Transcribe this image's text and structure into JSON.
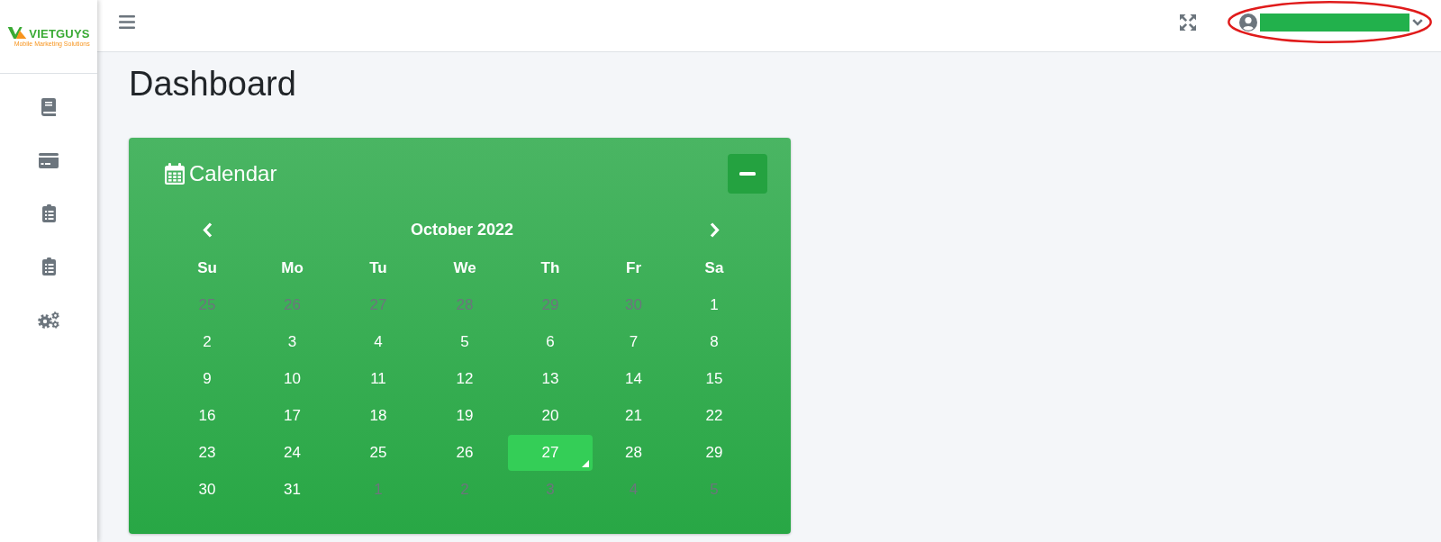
{
  "logo": {
    "name": "VIETGUYS",
    "tagline": "Mobile Marketing Solutions"
  },
  "page": {
    "title": "Dashboard"
  },
  "calendar": {
    "title": "Calendar",
    "month": "October 2022",
    "weekdays": [
      "Su",
      "Mo",
      "Tu",
      "We",
      "Th",
      "Fr",
      "Sa"
    ],
    "days": [
      {
        "label": "25",
        "muted": true,
        "selected": false,
        "today": false
      },
      {
        "label": "26",
        "muted": true,
        "selected": false,
        "today": false
      },
      {
        "label": "27",
        "muted": true,
        "selected": false,
        "today": false
      },
      {
        "label": "28",
        "muted": true,
        "selected": false,
        "today": false
      },
      {
        "label": "29",
        "muted": true,
        "selected": false,
        "today": false
      },
      {
        "label": "30",
        "muted": true,
        "selected": false,
        "today": false
      },
      {
        "label": "1",
        "muted": false,
        "selected": false,
        "today": false
      },
      {
        "label": "2",
        "muted": false,
        "selected": false,
        "today": false
      },
      {
        "label": "3",
        "muted": false,
        "selected": false,
        "today": false
      },
      {
        "label": "4",
        "muted": false,
        "selected": false,
        "today": false
      },
      {
        "label": "5",
        "muted": false,
        "selected": false,
        "today": false
      },
      {
        "label": "6",
        "muted": false,
        "selected": false,
        "today": false
      },
      {
        "label": "7",
        "muted": false,
        "selected": false,
        "today": false
      },
      {
        "label": "8",
        "muted": false,
        "selected": false,
        "today": false
      },
      {
        "label": "9",
        "muted": false,
        "selected": false,
        "today": false
      },
      {
        "label": "10",
        "muted": false,
        "selected": false,
        "today": false
      },
      {
        "label": "11",
        "muted": false,
        "selected": false,
        "today": false
      },
      {
        "label": "12",
        "muted": false,
        "selected": false,
        "today": false
      },
      {
        "label": "13",
        "muted": false,
        "selected": false,
        "today": false
      },
      {
        "label": "14",
        "muted": false,
        "selected": false,
        "today": false
      },
      {
        "label": "15",
        "muted": false,
        "selected": false,
        "today": false
      },
      {
        "label": "16",
        "muted": false,
        "selected": false,
        "today": false
      },
      {
        "label": "17",
        "muted": false,
        "selected": false,
        "today": false
      },
      {
        "label": "18",
        "muted": false,
        "selected": false,
        "today": false
      },
      {
        "label": "19",
        "muted": false,
        "selected": false,
        "today": false
      },
      {
        "label": "20",
        "muted": false,
        "selected": false,
        "today": false
      },
      {
        "label": "21",
        "muted": false,
        "selected": false,
        "today": false
      },
      {
        "label": "22",
        "muted": false,
        "selected": false,
        "today": false
      },
      {
        "label": "23",
        "muted": false,
        "selected": false,
        "today": false
      },
      {
        "label": "24",
        "muted": false,
        "selected": false,
        "today": false
      },
      {
        "label": "25",
        "muted": false,
        "selected": false,
        "today": false
      },
      {
        "label": "26",
        "muted": false,
        "selected": false,
        "today": false
      },
      {
        "label": "27",
        "muted": false,
        "selected": true,
        "today": true
      },
      {
        "label": "28",
        "muted": false,
        "selected": false,
        "today": false
      },
      {
        "label": "29",
        "muted": false,
        "selected": false,
        "today": false
      },
      {
        "label": "30",
        "muted": false,
        "selected": false,
        "today": false
      },
      {
        "label": "31",
        "muted": false,
        "selected": false,
        "today": false
      },
      {
        "label": "1",
        "muted": true,
        "selected": false,
        "today": false
      },
      {
        "label": "2",
        "muted": true,
        "selected": false,
        "today": false
      },
      {
        "label": "3",
        "muted": true,
        "selected": false,
        "today": false
      },
      {
        "label": "4",
        "muted": true,
        "selected": false,
        "today": false
      },
      {
        "label": "5",
        "muted": true,
        "selected": false,
        "today": false
      }
    ]
  }
}
